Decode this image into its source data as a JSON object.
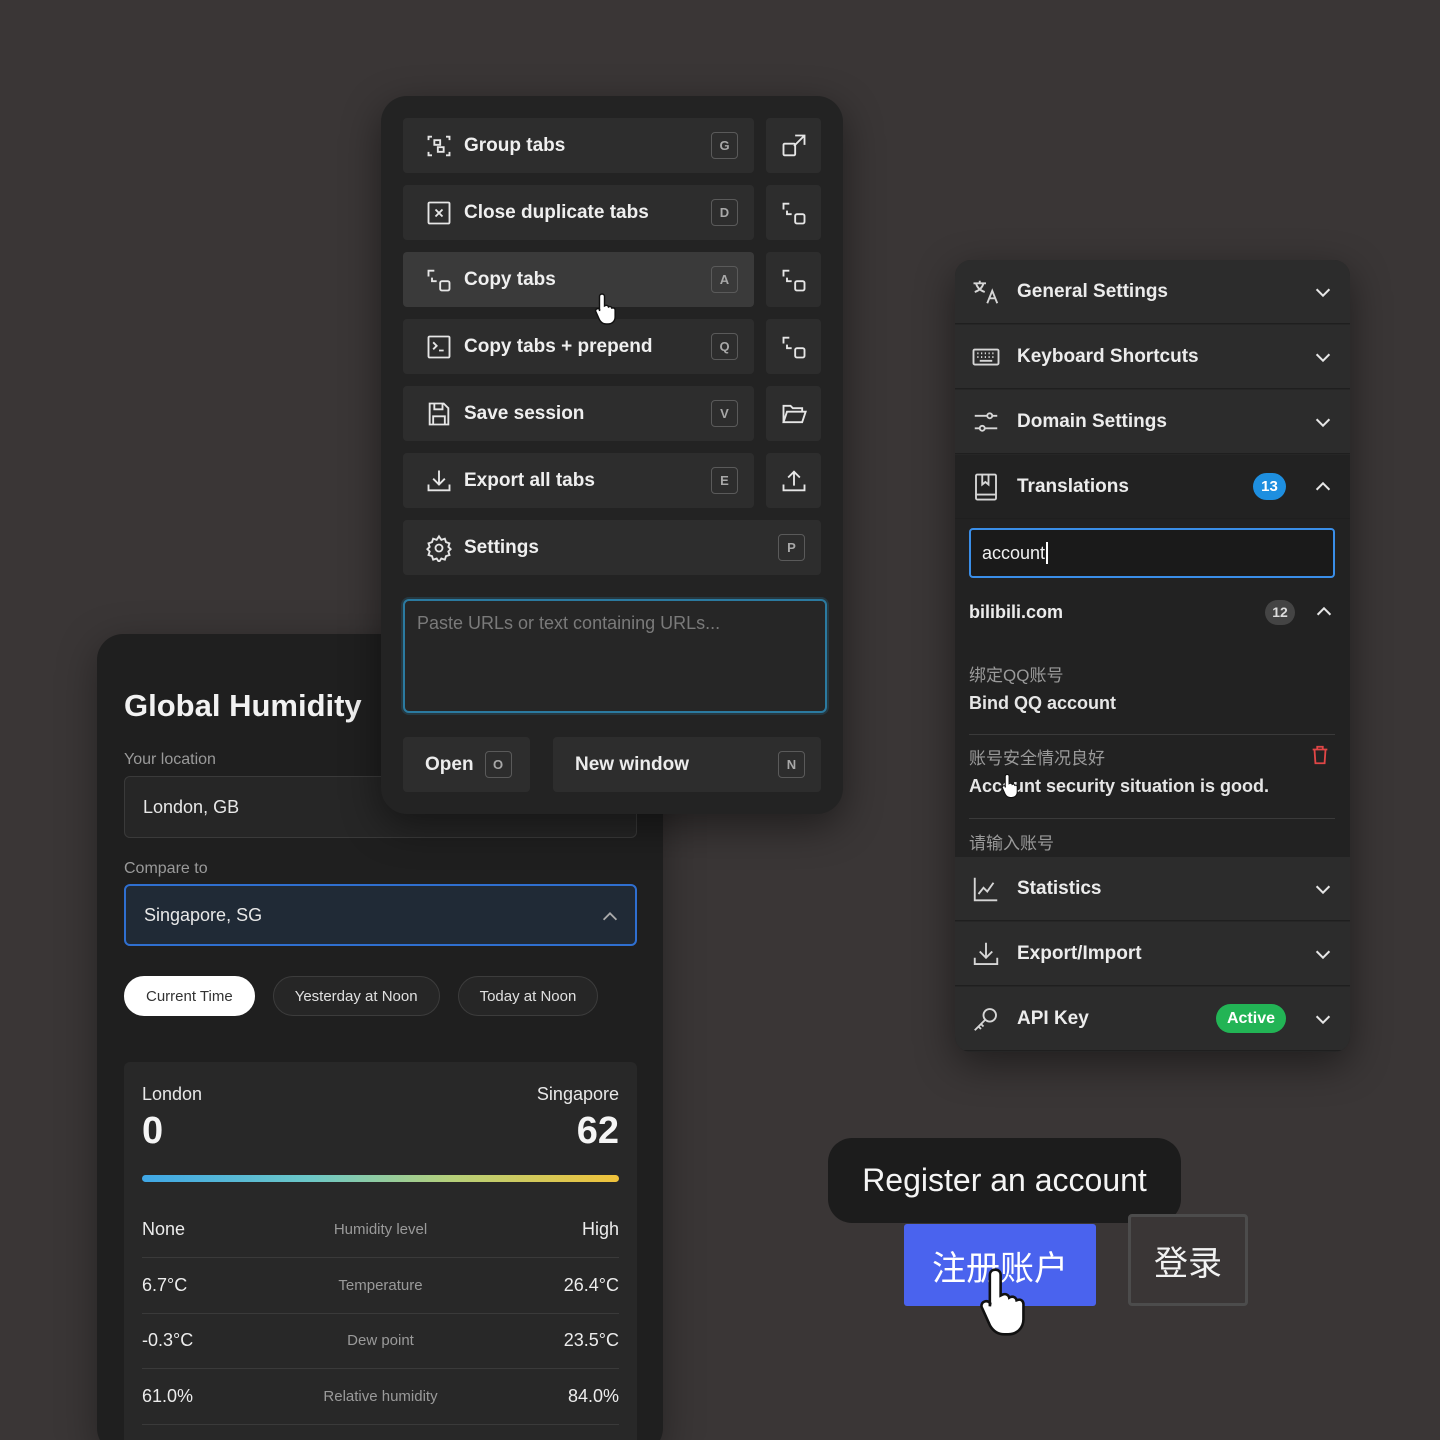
{
  "humidity": {
    "title": "Global Humidity",
    "location_label": "Your location",
    "location_value": "London, GB",
    "compare_label": "Compare to",
    "compare_value": "Singapore, SG",
    "time_pills": [
      "Current Time",
      "Yesterday at Noon",
      "Today at Noon"
    ],
    "selected_pill": "Current Time",
    "left_city": "London",
    "left_value": "0",
    "right_city": "Singapore",
    "right_value": "62",
    "rows": [
      {
        "left": "None",
        "metric": "Humidity level",
        "right": "High"
      },
      {
        "left": "6.7°C",
        "metric": "Temperature",
        "right": "26.4°C"
      },
      {
        "left": "-0.3°C",
        "metric": "Dew point",
        "right": "23.5°C"
      },
      {
        "left": "61.0%",
        "metric": "Relative humidity",
        "right": "84.0%"
      }
    ]
  },
  "tabmenu": {
    "items": [
      {
        "label": "Group tabs",
        "key": "G",
        "icon": "group-tabs-icon",
        "side_icon": "open-external-icon"
      },
      {
        "label": "Close duplicate tabs",
        "key": "D",
        "icon": "close-box-icon",
        "side_icon": "copy-icon"
      },
      {
        "label": "Copy tabs",
        "key": "A",
        "icon": "copy-icon",
        "side_icon": "copy-icon"
      },
      {
        "label": "Copy tabs + prepend",
        "key": "Q",
        "icon": "terminal-icon",
        "side_icon": "copy-icon"
      },
      {
        "label": "Save session",
        "key": "V",
        "icon": "save-icon",
        "side_icon": "folder-open-icon"
      },
      {
        "label": "Export all tabs",
        "key": "E",
        "icon": "download-icon",
        "side_icon": "upload-icon"
      },
      {
        "label": "Settings",
        "key": "P",
        "icon": "gear-icon"
      }
    ],
    "url_placeholder": "Paste URLs or text containing URLs...",
    "open_label": "Open",
    "open_key": "O",
    "new_window_label": "New window",
    "new_window_key": "N"
  },
  "settings": {
    "sections": [
      {
        "label": "General Settings",
        "icon": "translate-icon"
      },
      {
        "label": "Keyboard Shortcuts",
        "icon": "keyboard-icon"
      },
      {
        "label": "Domain Settings",
        "icon": "sliders-icon"
      },
      {
        "label": "Translations",
        "icon": "book-icon",
        "badge": "13"
      },
      {
        "label": "Statistics",
        "icon": "chart-icon"
      },
      {
        "label": "Export/Import",
        "icon": "download-icon"
      },
      {
        "label": "API Key",
        "icon": "key-icon",
        "badge": "Active"
      }
    ],
    "search_value": "account",
    "domain": "bilibili.com",
    "domain_count": "12",
    "translations": [
      {
        "zh": "绑定QQ账号",
        "en": "Bind QQ account"
      },
      {
        "zh": "账号安全情况良好",
        "en": "Account security situation is good."
      },
      {
        "zh": "请输入账号",
        "en": ""
      }
    ]
  },
  "register": {
    "tooltip": "Register an account",
    "register_label": "注册账户",
    "login_label": "登录"
  },
  "colors": {
    "background": "#3a3636",
    "accent_blue": "#4a63ee",
    "badge_blue": "#1e8fe0",
    "badge_green": "#22b455",
    "delete_red": "#e04646"
  }
}
